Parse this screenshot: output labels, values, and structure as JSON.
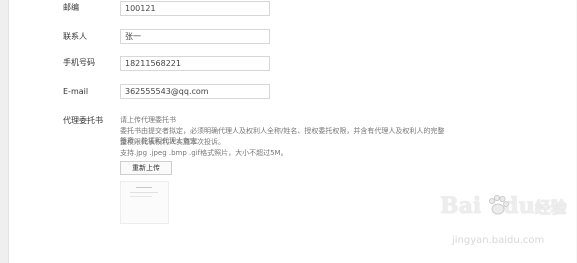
{
  "form": {
    "postcode": {
      "label": "邮编",
      "value": "100121"
    },
    "contact": {
      "label": "联系人",
      "value": "张一"
    },
    "mobile": {
      "label": "手机号码",
      "value": "18211568221"
    },
    "email": {
      "label": "E-mail",
      "value": "362555543@qq.com"
    },
    "proxy": {
      "label": "代理委托书",
      "desc_line1": "请上传代理委托书",
      "desc_line2": "委托书由提交者拟定，必须明确代理人及权利人全称/姓名、授权委托权限，并含有代理人及权利人的完整签章，能证明代理人有完",
      "desc_line3": "整权限代表权利人实施本次投诉。",
      "desc_line4": "支持.jpg .jpeg .bmp .gif格式照片，大小不超过5M。",
      "reupload_label": "重新上传"
    }
  },
  "watermark": {
    "brand": "Bai",
    "brand_suffix": "经验",
    "url": "jingyan.baidu.com"
  }
}
